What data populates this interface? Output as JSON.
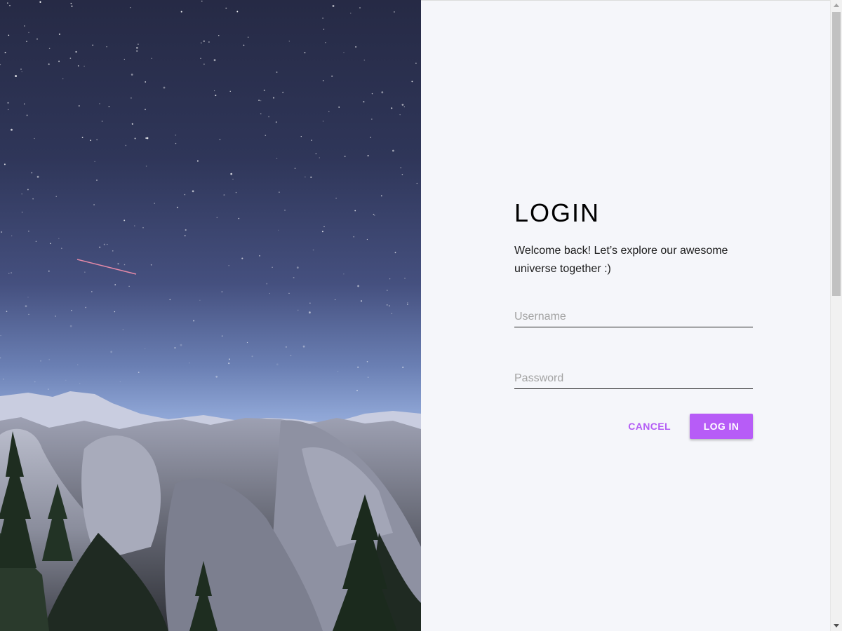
{
  "login": {
    "title": "LOGIN",
    "subtitle": "Welcome back! Let’s explore our awesome universe together :)",
    "username": {
      "placeholder": "Username",
      "value": ""
    },
    "password": {
      "placeholder": "Password",
      "value": ""
    },
    "cancel_label": "CANCEL",
    "login_label": "LOG IN"
  },
  "colors": {
    "accent": "#b75cf7",
    "panel_background": "#f5f6fa"
  },
  "icons": {
    "scroll_up": "scroll-up-arrow-icon",
    "scroll_down": "scroll-down-arrow-icon"
  }
}
